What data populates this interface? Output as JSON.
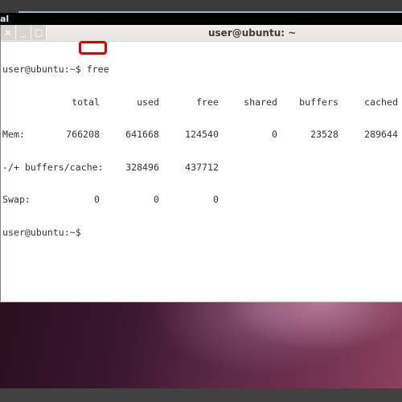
{
  "menubar": {
    "app_label_fragment": "al"
  },
  "window": {
    "title": "user@ubuntu: ~",
    "buttons": {
      "close": "×",
      "minimize": "_",
      "maximize": "□"
    }
  },
  "terminal": {
    "prompt": "user@ubuntu:~$ ",
    "command": "free",
    "headers": [
      "total",
      "used",
      "free",
      "shared",
      "buffers",
      "cached"
    ],
    "rows": [
      {
        "label": "Mem:",
        "values": [
          "766208",
          "641668",
          "124540",
          "0",
          "23528",
          "289644"
        ]
      },
      {
        "label": "-/+ buffers/cache:",
        "values": [
          "",
          "328496",
          "437712",
          "",
          "",
          ""
        ]
      },
      {
        "label": "Swap:",
        "values": [
          "0",
          "0",
          "0",
          "",
          "",
          ""
        ]
      }
    ],
    "final_prompt": "user@ubuntu:~$"
  },
  "annotation": {
    "highlight_color": "#e00000",
    "highlighted_text": "free"
  }
}
